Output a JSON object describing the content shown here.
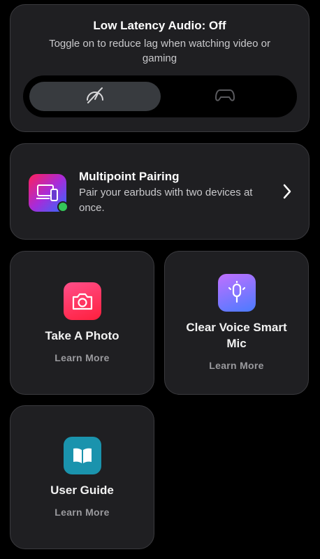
{
  "latency": {
    "title": "Low Latency Audio: Off",
    "subtitle": "Toggle on to reduce lag when watching video or gaming",
    "active_option_icon": "speedometer-off-icon",
    "inactive_option_icon": "gamepad-icon"
  },
  "multipoint": {
    "title": "Multipoint Pairing",
    "subtitle": "Pair your earbuds with two devices at once.",
    "icon": "devices-icon",
    "status_color": "#34c759"
  },
  "tiles": [
    {
      "label": "Take A Photo",
      "link": "Learn More",
      "icon": "camera-icon",
      "color": "#ff2d6b"
    },
    {
      "label": "Clear Voice Smart Mic",
      "link": "Learn More",
      "icon": "microphone-icon",
      "color": "#8f63ff"
    },
    {
      "label": "User Guide",
      "link": "Learn More",
      "icon": "book-icon",
      "color": "#1aa3c2"
    }
  ]
}
